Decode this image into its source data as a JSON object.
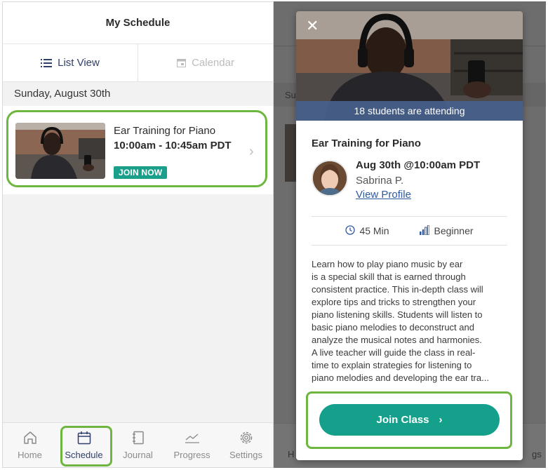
{
  "header": {
    "title": "My Schedule"
  },
  "tabs": [
    {
      "label": "List View",
      "icon": "list-icon",
      "active": true
    },
    {
      "label": "Calendar",
      "icon": "calendar-icon",
      "active": false
    }
  ],
  "schedule": {
    "date_heading": "Sunday, August 30th",
    "class_card": {
      "title": "Ear Training for Piano",
      "time": "10:00am - 10:45am PDT",
      "badge": "JOIN NOW"
    }
  },
  "bottom_nav": [
    {
      "label": "Home",
      "icon": "home-icon",
      "active": false
    },
    {
      "label": "Schedule",
      "icon": "calendar-icon",
      "active": true
    },
    {
      "label": "Journal",
      "icon": "journal-icon",
      "active": false
    },
    {
      "label": "Progress",
      "icon": "chart-icon",
      "active": false
    },
    {
      "label": "Settings",
      "icon": "gear-icon",
      "active": false
    }
  ],
  "background_fragments": {
    "date_fragment": "Su",
    "nav_fragment_left": "H",
    "nav_fragment_right": "gs"
  },
  "modal": {
    "attending": "18 students are attending",
    "title": "Ear Training for Piano",
    "when": "Aug 30th @10:00am PDT",
    "teacher": "Sabrina P.",
    "profile_link": "View Profile",
    "duration": "45 Min",
    "level": "Beginner",
    "description_lines": [
      "Learn how to play piano music by ear",
      "is a special skill that is earned through",
      "consistent practice. This in-depth class will",
      "explore tips and tricks to strengthen your",
      "piano listening skills. Students will listen to",
      "basic piano melodies to deconstruct and",
      "analyze the musical notes and harmonies.",
      "A live teacher will guide the class in real-",
      "time to explain strategies for listening to",
      "piano melodies and developing the ear tra..."
    ],
    "join_button": "Join Class"
  },
  "colors": {
    "accent": "#15a08c",
    "highlight": "#6fb640",
    "nav_active": "#2f3f6a",
    "attending_bar": "#465f8c"
  }
}
